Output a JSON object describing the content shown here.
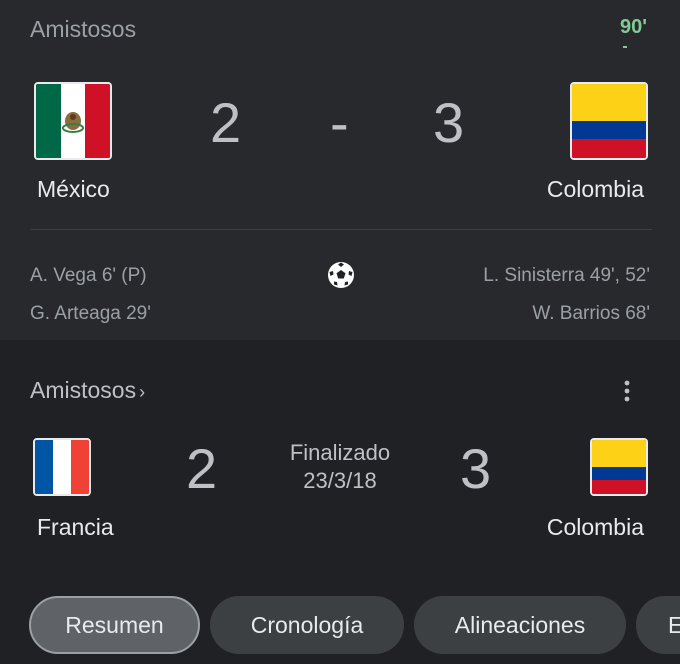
{
  "live_match": {
    "competition": "Amistosos",
    "minute": "90'",
    "home": {
      "name": "México",
      "score": "2",
      "flag": "mexico-flag"
    },
    "away": {
      "name": "Colombia",
      "score": "3",
      "flag": "colombia-flag"
    },
    "separator": "-",
    "home_scorers": [
      "A. Vega 6' (P)",
      "G. Arteaga 29'"
    ],
    "away_scorers": [
      "L. Sinisterra 49', 52'",
      "W. Barrios 68'"
    ],
    "goal_icon": "soccer-ball-icon"
  },
  "past_match": {
    "competition": "Amistosos",
    "competition_chevron": "›",
    "home": {
      "name": "Francia",
      "score": "2",
      "flag": "france-flag"
    },
    "away": {
      "name": "Colombia",
      "score": "3",
      "flag": "colombia-flag"
    },
    "status": "Finalizado",
    "date": "23/3/18",
    "menu_icon": "more-vert-icon"
  },
  "tabs": [
    "Resumen",
    "Cronología",
    "Alineaciones",
    "E"
  ],
  "selected_tab": "Resumen",
  "colors": {
    "background": "#202124",
    "card": "#28292c",
    "live_green": "#81c995",
    "chip": "#3c4043",
    "chip_selected": "#5f6368"
  }
}
